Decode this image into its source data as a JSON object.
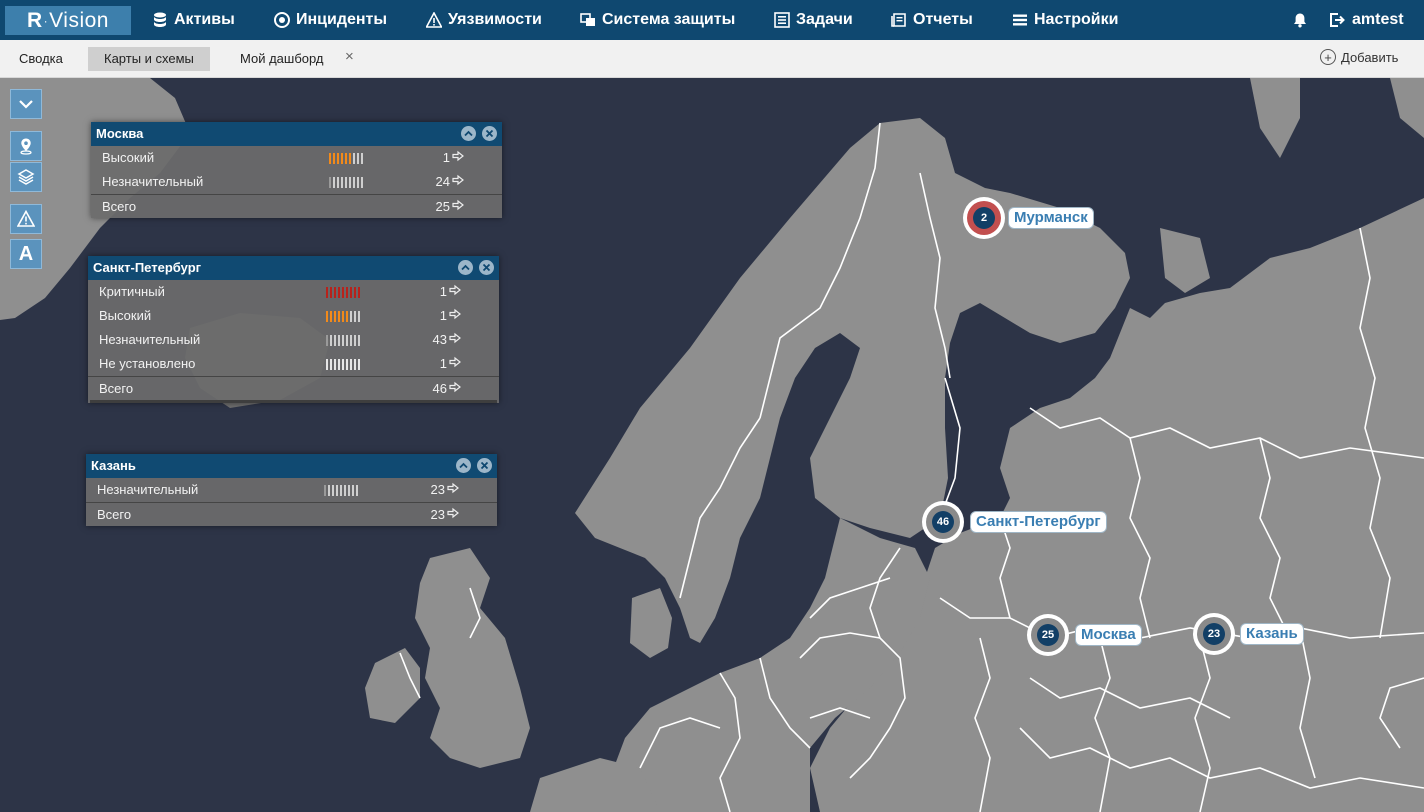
{
  "app": {
    "logo_left": "R",
    "logo_right": "Vision"
  },
  "nav": {
    "items": [
      {
        "label": "Активы",
        "icon": "database-icon"
      },
      {
        "label": "Инциденты",
        "icon": "target-icon"
      },
      {
        "label": "Уязвимости",
        "icon": "warning-icon"
      },
      {
        "label": "Система защиты",
        "icon": "windows-icon"
      },
      {
        "label": "Задачи",
        "icon": "tasks-icon"
      },
      {
        "label": "Отчеты",
        "icon": "reports-icon"
      },
      {
        "label": "Настройки",
        "icon": "menu-icon"
      }
    ],
    "user": "amtest"
  },
  "tabs": {
    "items": [
      {
        "label": "Сводка"
      },
      {
        "label": "Карты и схемы"
      },
      {
        "label": "Мой дашборд"
      }
    ],
    "close_glyph": "×",
    "add_label": "Добавить",
    "add_glyph": "+"
  },
  "toolbar": {
    "font_glyph": "A"
  },
  "colors": {
    "brand": "#0f4870",
    "critical": "#b8221b",
    "high": "#f28a1a",
    "low": "#cfcfcf",
    "marker_red": "#c24f4f"
  },
  "panels": [
    {
      "title": "Москва",
      "rows": [
        {
          "label": "Высокий",
          "count": "1",
          "level": "high"
        },
        {
          "label": "Незначительный",
          "count": "24",
          "level": "low"
        }
      ],
      "total": {
        "label": "Всего",
        "count": "25"
      }
    },
    {
      "title": "Санкт-Петербург",
      "rows": [
        {
          "label": "Критичный",
          "count": "1",
          "level": "critical"
        },
        {
          "label": "Высокий",
          "count": "1",
          "level": "high"
        },
        {
          "label": "Незначительный",
          "count": "43",
          "level": "low"
        },
        {
          "label": "Не установлено",
          "count": "1",
          "level": "none"
        }
      ],
      "total": {
        "label": "Всего",
        "count": "46"
      }
    },
    {
      "title": "Казань",
      "rows": [
        {
          "label": "Незначительный",
          "count": "23",
          "level": "low"
        }
      ],
      "total": {
        "label": "Всего",
        "count": "23"
      }
    }
  ],
  "markers": [
    {
      "city": "Мурманск",
      "count": "2"
    },
    {
      "city": "Санкт-Петербург",
      "count": "46"
    },
    {
      "city": "Москва",
      "count": "25"
    },
    {
      "city": "Казань",
      "count": "23"
    }
  ]
}
